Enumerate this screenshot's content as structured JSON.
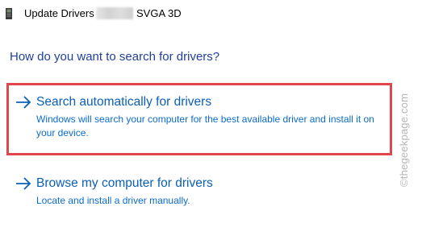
{
  "window": {
    "title_prefix": "Update Drivers - ",
    "title_device": "SVGA 3D",
    "title_icon": "device-driver-icon"
  },
  "main": {
    "question": "How do you want to search for drivers?",
    "options": [
      {
        "title": "Search automatically for drivers",
        "description": "Windows will search your computer for the best available driver and install it on your device.",
        "icon": "arrow-right-icon",
        "highlighted": true
      },
      {
        "title": "Browse my computer for drivers",
        "description": "Locate and install a driver manually.",
        "icon": "arrow-right-icon",
        "highlighted": false
      }
    ]
  },
  "watermark": {
    "text": "©thegeekpage.com"
  },
  "colors": {
    "accent": "#0b5fb5",
    "heading": "#1f3f9a",
    "highlight_border": "#e0474c"
  }
}
